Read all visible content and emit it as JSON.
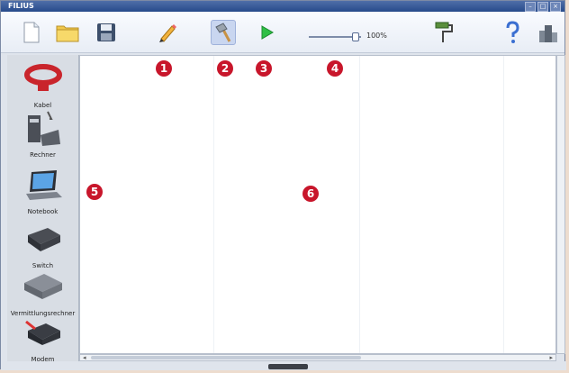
{
  "window": {
    "title": "FILIUS",
    "controls": [
      "–",
      "□",
      "×"
    ]
  },
  "toolbar": {
    "zoom_value": "100%",
    "zoom_fraction": 0.9
  },
  "markers": [
    "1",
    "2",
    "3",
    "4",
    "5",
    "6"
  ],
  "palette": {
    "items": [
      {
        "label": "Kabel"
      },
      {
        "label": "Rechner"
      },
      {
        "label": "Notebook"
      },
      {
        "label": "Switch"
      },
      {
        "label": "Vermittlungsrechner"
      },
      {
        "label": "Modem"
      }
    ]
  }
}
